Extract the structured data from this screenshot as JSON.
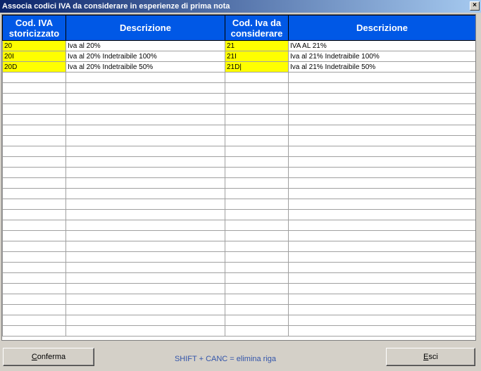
{
  "window": {
    "title": "Associa codici IVA da considerare in esperienze di prima nota",
    "close_label": "×"
  },
  "grid": {
    "headers": [
      [
        "Cod. IVA",
        "storicizzato"
      ],
      [
        "Descrizione"
      ],
      [
        "Cod. Iva da",
        "considerare"
      ],
      [
        "Descrizione"
      ]
    ],
    "rows": [
      [
        "20",
        "Iva al 20%",
        "21",
        "IVA AL 21%"
      ],
      [
        "20I",
        "Iva al 20% Indetraibile 100%",
        "21I",
        "Iva al 21% Indetraibile 100%"
      ],
      [
        "20D",
        "Iva al 20% Indetraibile 50%",
        "21D|",
        "Iva al 21% Indetraibile 50%"
      ]
    ],
    "empty_row_count": 25
  },
  "footer": {
    "confirm_mnemonic": "C",
    "confirm_rest": "onferma",
    "hint": "SHIFT + CANC = elimina riga",
    "exit_mnemonic": "E",
    "exit_rest": "sci"
  }
}
